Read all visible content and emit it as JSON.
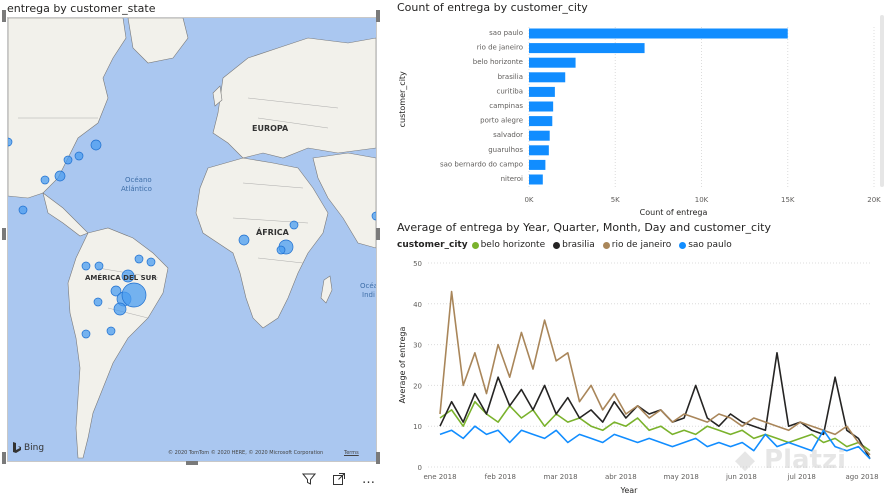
{
  "map": {
    "title": "entrega by customer_state",
    "labels": {
      "europa": "EUROPA",
      "africa": "ÁFRICA",
      "america_sur": "AMÉRICA DEL SUR",
      "oceano": "Océano",
      "atlantico": "Atlántico",
      "ocean_right_1": "Océa",
      "ocean_right_2": "Indi"
    },
    "bing_label": "Bing",
    "copyright": "© 2020 TomTom © 2020 HERE, © 2020 Microsoft Corporation",
    "terms": "Terms"
  },
  "toolbar": {
    "filter": "filter-icon",
    "focus": "focus-mode-icon",
    "more": "…"
  },
  "bar_chart_data": {
    "type": "bar",
    "title": "Count of entrega by customer_city",
    "ylabel": "customer_city",
    "xlabel": "Count of entrega",
    "categories": [
      "sao paulo",
      "rio de janeiro",
      "belo horizonte",
      "brasilia",
      "curitiba",
      "campinas",
      "porto alegre",
      "salvador",
      "guarulhos",
      "sao bernardo do campo",
      "niteroi"
    ],
    "values": [
      15000,
      6700,
      2700,
      2100,
      1500,
      1400,
      1350,
      1200,
      1150,
      950,
      800
    ],
    "xlim": [
      0,
      20000
    ],
    "xticks": [
      "0K",
      "5K",
      "10K",
      "15K",
      "20K"
    ],
    "color": "#118dff"
  },
  "chart_data": {
    "type": "line",
    "title": "Average of entrega by Year, Quarter, Month, Day and customer_city",
    "legend_title": "customer_city",
    "xlabel": "Year",
    "ylabel": "Average of entrega",
    "ylim": [
      0,
      50
    ],
    "yticks": [
      "0",
      "10",
      "20",
      "30",
      "40",
      "50"
    ],
    "xticks": [
      "ene 2018",
      "feb 2018",
      "mar 2018",
      "abr 2018",
      "may 2018",
      "jun 2018",
      "jul 2018",
      "ago 2018"
    ],
    "series": [
      {
        "name": "belo horizonte",
        "color": "#7ab22c",
        "values": [
          12,
          14,
          10,
          16,
          13,
          11,
          15,
          12,
          14,
          10,
          13,
          11,
          12,
          10,
          9,
          11,
          10,
          12,
          9,
          10,
          8,
          9,
          8,
          10,
          9,
          8,
          9,
          7,
          8,
          7,
          6,
          7,
          8,
          6,
          7,
          5,
          6,
          4
        ]
      },
      {
        "name": "brasilia",
        "color": "#252423",
        "values": [
          10,
          16,
          11,
          18,
          13,
          22,
          15,
          19,
          14,
          20,
          13,
          17,
          12,
          14,
          11,
          16,
          12,
          15,
          13,
          14,
          11,
          12,
          20,
          12,
          10,
          13,
          11,
          10,
          9,
          28,
          10,
          11,
          9,
          8,
          22,
          9,
          7,
          2
        ]
      },
      {
        "name": "rio de janeiro",
        "color": "#a9865a",
        "values": [
          13,
          43,
          20,
          28,
          18,
          30,
          22,
          33,
          24,
          36,
          26,
          28,
          16,
          20,
          14,
          18,
          13,
          15,
          12,
          14,
          11,
          13,
          12,
          11,
          13,
          12,
          10,
          12,
          11,
          10,
          9,
          11,
          10,
          9,
          8,
          10,
          6,
          3
        ]
      },
      {
        "name": "sao paulo",
        "color": "#118dff",
        "values": [
          8,
          9,
          7,
          10,
          8,
          9,
          6,
          9,
          8,
          7,
          9,
          6,
          8,
          7,
          6,
          8,
          7,
          6,
          7,
          6,
          5,
          6,
          7,
          5,
          6,
          5,
          6,
          4,
          8,
          5,
          6,
          5,
          4,
          9,
          5,
          4,
          5,
          2
        ]
      }
    ]
  }
}
